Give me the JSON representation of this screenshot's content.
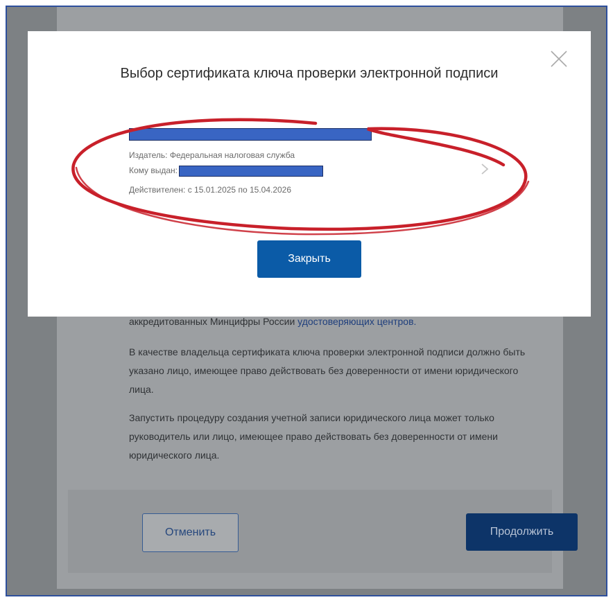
{
  "modal": {
    "title": "Выбор сертификата ключа проверки электронной подписи",
    "close_icon": "close-icon",
    "close_button_label": "Закрыть",
    "certificate": {
      "issuer_label": "Издатель:",
      "issuer_value": "Федеральная налоговая служба",
      "issued_to_label": "Кому выдан:",
      "validity_label": "Действителен:",
      "validity_from_prefix": "с",
      "validity_from": "15.01.2025",
      "validity_to_prefix": "по",
      "validity_to": "15.04.2026",
      "chevron_icon": "chevron-right-icon"
    },
    "annotation_color": "#c8202a"
  },
  "background": {
    "text_line1_start": "аккредитованных Минцифры России",
    "text_line1_link": "удостоверяющих центров.",
    "paragraph2": "В качестве владельца сертификата ключа проверки электронной подписи должно быть указано лицо, имеющее право действовать без доверенности от имени юридического лица.",
    "paragraph3": "Запустить процедуру создания учетной записи юридического лица может только руководитель или лицо, имеющее право действовать без доверенности от имени юридического лица.",
    "cancel_label": "Отменить",
    "continue_label": "Продолжить"
  },
  "colors": {
    "primary": "#0b5ba7",
    "redaction": "#3965c3",
    "frame_border": "#2d4f9c"
  }
}
